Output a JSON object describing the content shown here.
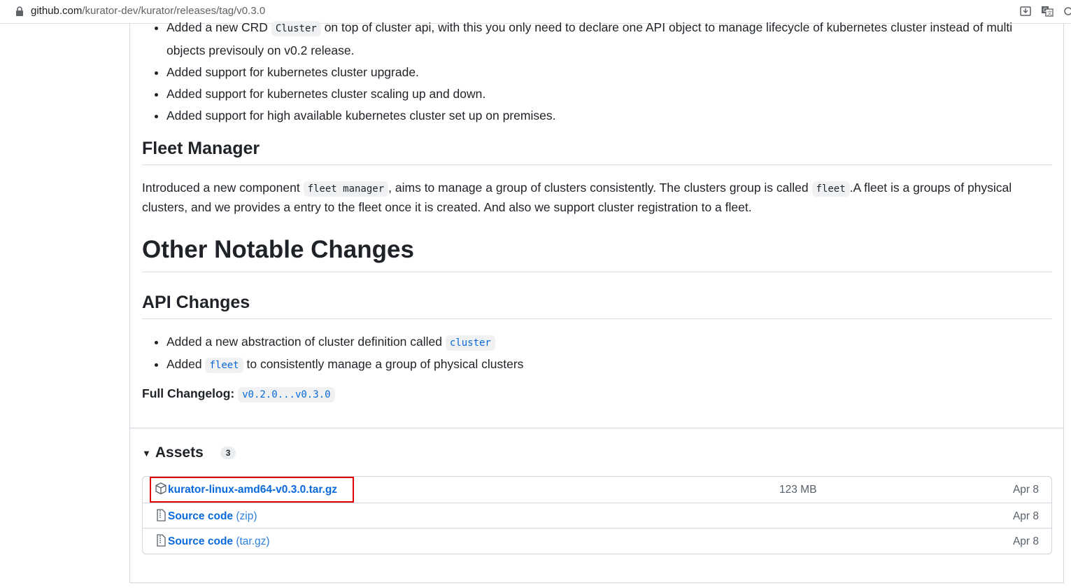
{
  "browser": {
    "url_host": "github.com",
    "url_path": "/kurator-dev/kurator/releases/tag/v0.3.0"
  },
  "top_bullets": {
    "item1_part1": "Added a new CRD ",
    "item1_code": "Cluster",
    "item1_part2": " on top of cluster api, with this you only need to declare one API object to manage lifecycle of kubernetes cluster instead of multi",
    "item1_line2": "objects previsouly on v0.2 release.",
    "item2": "Added support for kubernetes cluster upgrade.",
    "item3": "Added support for kubernetes cluster scaling up and down.",
    "item4": "Added support for high available kubernetes cluster set up on premises."
  },
  "fleet_manager": {
    "heading": "Fleet Manager",
    "p_part1": "Introduced a new component ",
    "p_code1": "fleet manager",
    "p_part2": ", aims to manage a group of clusters consistently. The clusters group is called ",
    "p_code2": "fleet",
    "p_part3": ".A fleet is a groups of physical",
    "p_line2": "clusters, and we provides a entry to the fleet once it is created. And also we support cluster registration to a fleet."
  },
  "other_changes": {
    "heading": "Other Notable Changes"
  },
  "api_changes": {
    "heading": "API Changes",
    "item1_text": "Added a new abstraction of cluster definition called ",
    "item1_code": "cluster",
    "item2_part1": "Added ",
    "item2_code": "fleet",
    "item2_part2": " to consistently manage a group of physical clusters"
  },
  "full_changelog": {
    "label": "Full Changelog",
    "link": "v0.2.0...v0.3.0"
  },
  "assets": {
    "heading": "Assets",
    "count": "3",
    "rows": [
      {
        "name": "kurator-linux-amd64-v0.3.0.tar.gz",
        "suffix": "",
        "size": "123 MB",
        "date": "Apr 8",
        "icon": "package-icon"
      },
      {
        "name": "Source code",
        "suffix": "(zip)",
        "size": "",
        "date": "Apr 8",
        "icon": "file-zip-icon"
      },
      {
        "name": "Source code",
        "suffix": "(tar.gz)",
        "size": "",
        "date": "Apr 8",
        "icon": "file-zip-icon"
      }
    ]
  },
  "colors": {
    "link": "#0969da",
    "highlight_border": "#e00000"
  }
}
